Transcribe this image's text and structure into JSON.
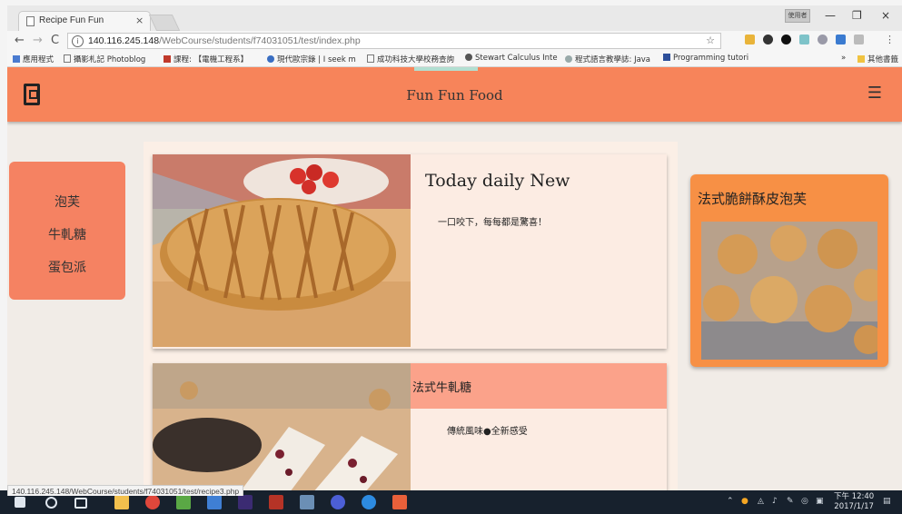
{
  "browser": {
    "tab_title": "Recipe Fun Fun",
    "tab_close": "×",
    "avatar_label": "使用者",
    "minimize": "—",
    "restore": "❐",
    "close": "×",
    "back": "←",
    "forward": "→",
    "reload": "C",
    "url_host": "140.116.245.148",
    "url_path": "/WebCourse/students/f74031051/test/index.php",
    "bookmarks": [
      "應用程式",
      "攝影札記 Photoblog",
      "課程: 【電機工程系】",
      "現代歐宗錄 | I seek m",
      "成功科技大學校務查詢",
      "Stewart Calculus Inte",
      "程式語言教學誌: Java",
      "Programming tutori",
      "»",
      "其他書籤"
    ],
    "status_url": "140.116.245.148/WebCourse/students/f74031051/test/recipe3.php"
  },
  "site": {
    "brand": "Fun Fun Food",
    "menu_icon": "☰",
    "sidebar": [
      "泡芙",
      "牛軋糖",
      "蛋包派"
    ],
    "card1": {
      "title": "Today daily New",
      "subtitle": "一口咬下，每每都是驚喜！"
    },
    "card2": {
      "title": "法式牛軋糖",
      "subtitle": "傳統風味●全新感受"
    },
    "side_card": {
      "title": "法式脆餅酥皮泡芙"
    }
  },
  "taskbar": {
    "time": "下午 12:40",
    "date": "2017/1/17"
  },
  "colors": {
    "header": "#f7845a",
    "sidebar": "#f58262",
    "side_card": "#f79045",
    "card2_band": "#fba28a"
  }
}
